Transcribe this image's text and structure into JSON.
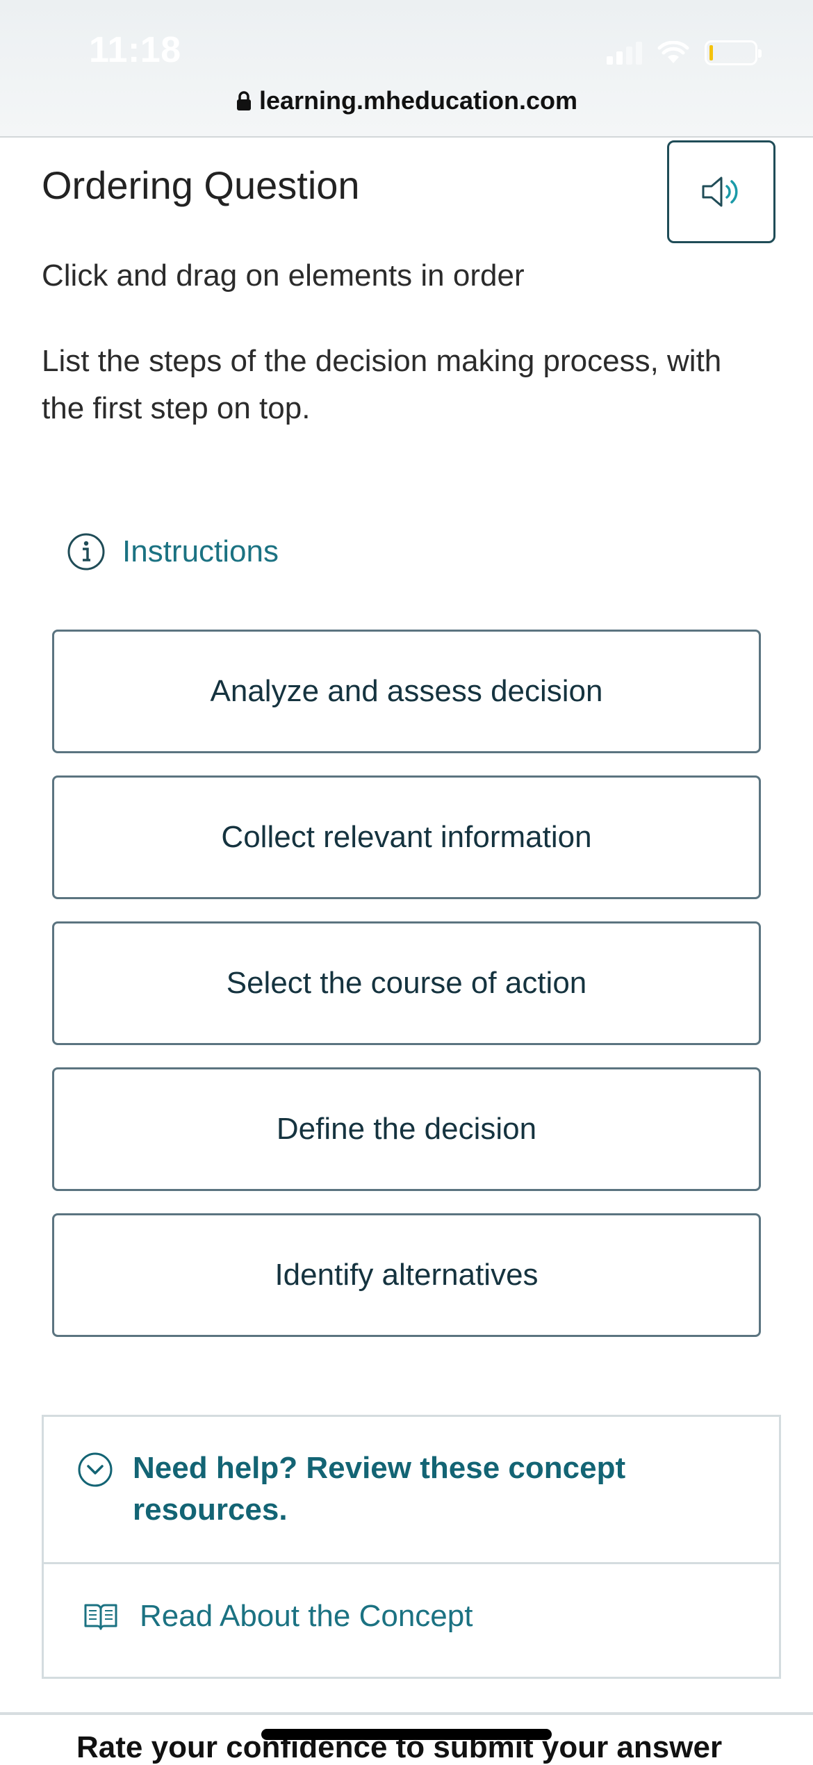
{
  "status_bar": {
    "time": "11:18"
  },
  "browser": {
    "url": "learning.mheducation.com"
  },
  "question": {
    "title": "Ordering Question",
    "prompt": "Click and drag on elements in order",
    "text": "List the steps of the decision making process, with the first step on top."
  },
  "instructions": {
    "label": "Instructions"
  },
  "order_items": [
    {
      "label": "Analyze and assess decision"
    },
    {
      "label": "Collect relevant information"
    },
    {
      "label": "Select the course of action"
    },
    {
      "label": "Define the decision"
    },
    {
      "label": "Identify alternatives"
    }
  ],
  "help": {
    "title": "Need help? Review these concept resources.",
    "read_link": "Read About the Concept"
  },
  "footer": {
    "confidence_text": "Rate your confidence to submit your answer"
  },
  "colors": {
    "accent": "#1b7282",
    "item_border": "#5b7480",
    "battery": "#f4c20d"
  },
  "icons": {
    "lock": "lock-icon",
    "audio": "speaker-icon",
    "info": "info-icon",
    "chevron": "chevron-down-circle-icon",
    "book": "book-icon"
  }
}
